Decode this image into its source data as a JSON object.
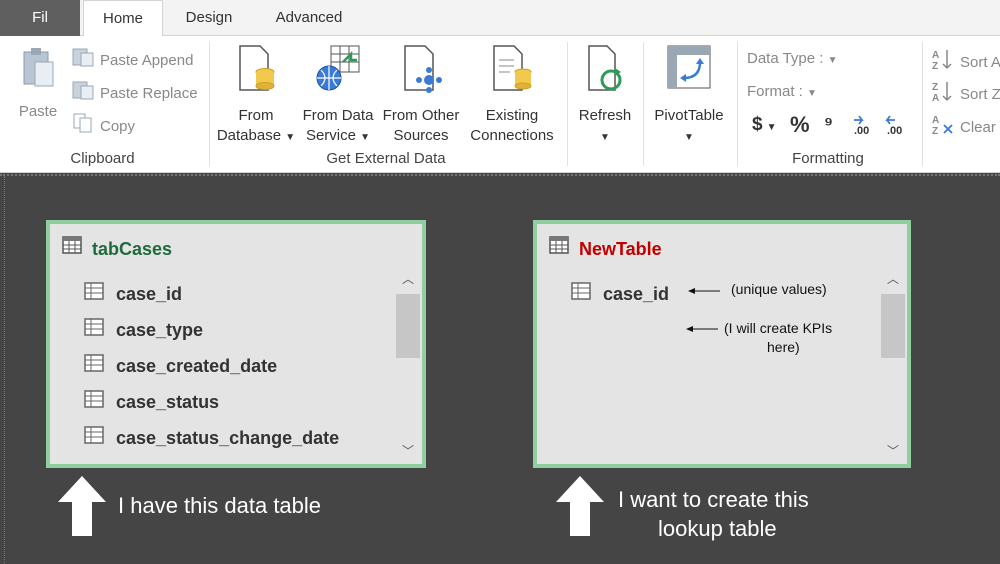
{
  "tabs": {
    "file": "Fil",
    "home": "Home",
    "design": "Design",
    "advanced": "Advanced"
  },
  "clipboard": {
    "paste": "Paste",
    "paste_append": "Paste Append",
    "paste_replace": "Paste Replace",
    "copy": "Copy",
    "group_label": "Clipboard"
  },
  "external_data": {
    "from_database_1": "From",
    "from_database_2": "Database",
    "from_data_service_1": "From Data",
    "from_data_service_2": "Service",
    "from_other_sources_1": "From Other",
    "from_other_sources_2": "Sources",
    "existing_connections_1": "Existing",
    "existing_connections_2": "Connections",
    "group_label": "Get External Data"
  },
  "refresh": {
    "label": "Refresh"
  },
  "pivot": {
    "label": "PivotTable"
  },
  "formatting": {
    "data_type": "Data Type :",
    "format": "Format :",
    "currency": "$",
    "percent": "%",
    "comma": "⁹",
    "group_label": "Formatting"
  },
  "sort": {
    "sort_az": "Sort A",
    "sort_za": "Sort Z",
    "clear": "Clear"
  },
  "tables": {
    "left": {
      "name": "tabCases",
      "name_color": "#1e6b3c",
      "columns": [
        "case_id",
        "case_type",
        "case_created_date",
        "case_status",
        "case_status_change_date"
      ]
    },
    "right": {
      "name": "NewTable",
      "name_color": "#c00000",
      "columns": [
        "case_id"
      ]
    }
  },
  "notes": {
    "unique": "(unique values)",
    "kpi_1": "(I will create KPIs",
    "kpi_2": "here)"
  },
  "captions": {
    "left": "I have this data table",
    "right_1": "I want to create this",
    "right_2": "lookup table"
  }
}
